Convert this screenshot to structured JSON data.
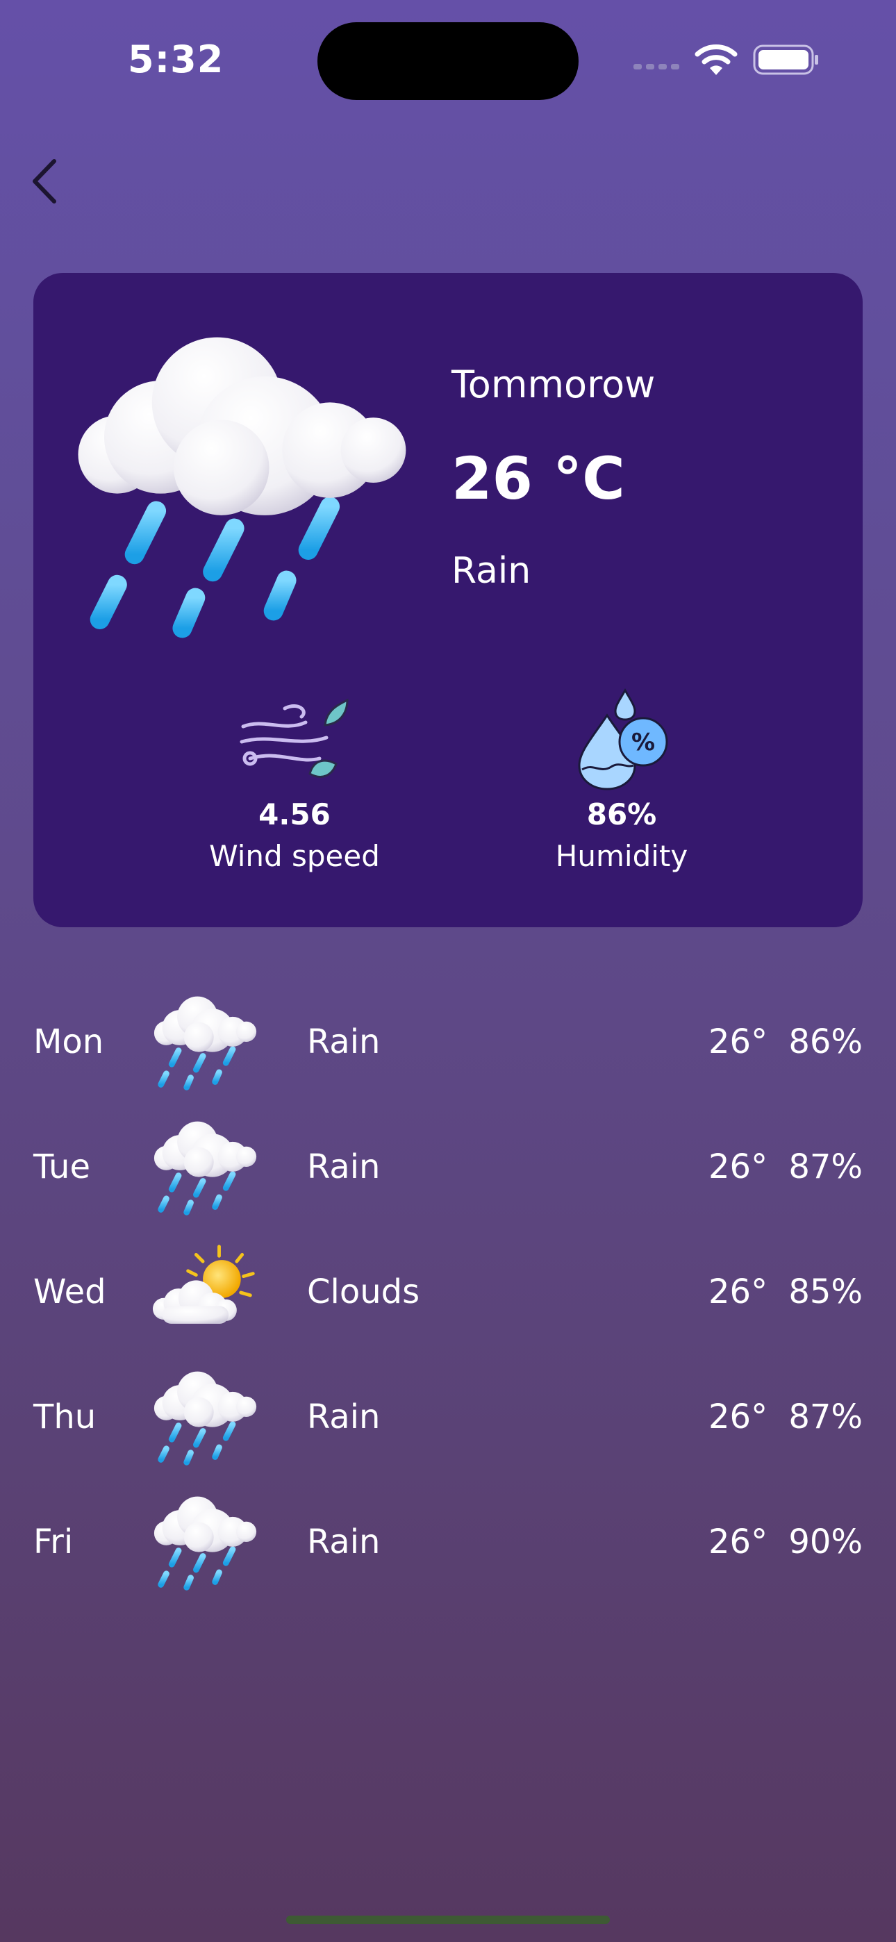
{
  "status_bar": {
    "time": "5:32"
  },
  "header": {
    "back_icon": "chevron-left-icon"
  },
  "card": {
    "day": "Tommorow",
    "temperature": "26 °C",
    "condition": "Rain",
    "icon": "rain-cloud-icon",
    "wind": {
      "value": "4.56",
      "label": "Wind speed",
      "icon": "wind-icon"
    },
    "humidity": {
      "value": "86%",
      "label": "Humidity",
      "icon": "humidity-drop-icon"
    }
  },
  "forecast": [
    {
      "day": "Mon",
      "condition": "Rain",
      "temp": "26°",
      "humidity": "86%",
      "icon": "rain-cloud-icon"
    },
    {
      "day": "Tue",
      "condition": "Rain",
      "temp": "26°",
      "humidity": "87%",
      "icon": "rain-cloud-icon"
    },
    {
      "day": "Wed",
      "condition": "Clouds",
      "temp": "26°",
      "humidity": "85%",
      "icon": "sun-cloud-icon"
    },
    {
      "day": "Thu",
      "condition": "Rain",
      "temp": "26°",
      "humidity": "87%",
      "icon": "rain-cloud-icon"
    },
    {
      "day": "Fri",
      "condition": "Rain",
      "temp": "26°",
      "humidity": "90%",
      "icon": "rain-cloud-icon"
    }
  ],
  "colors": {
    "card_bg": "#36186e",
    "rain_blue": "#3ab8f0",
    "sun_yellow": "#f5c31c"
  }
}
